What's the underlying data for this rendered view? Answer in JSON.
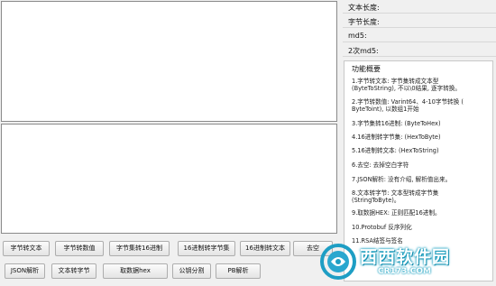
{
  "info": {
    "text_length_label": "文本长度:",
    "byte_length_label": "字节长度:",
    "md5_label": "md5:",
    "md5_twice_label": "2次md5:"
  },
  "description": {
    "title": "功能概要",
    "items": [
      "1.字节转文本: 字节集转成文本型\n(ByteToString), 不以\\0结果, 逐字转换。",
      "2.字节转数值: Varint64、4-10字节转换 (\nByteToint), 以数组1开始",
      "3.字节集转16进制: (ByteToHex)",
      "4.16进制转字节集: (HexToByte)",
      "5.16进制转文本: (HexToString)",
      "6.去空: 去掉空白字符",
      "7.JSON解析: 没有介绍, 解析值出来。",
      "8.文本转字节: 文本型转成字节集\n(StringToByte)。",
      "9.取数据HEX: 正则匹配16进制。",
      "10.Protobuf 反序列化",
      "11.RSA结签与签名"
    ]
  },
  "buttons_row1": [
    "字节转文本",
    "字节转数值",
    "字节集转16进制",
    "16进制转字节集",
    "16进制转文本",
    "去空"
  ],
  "buttons_row2": [
    "JSON解析",
    "文本转字节",
    "取数据hex",
    "公钥分割",
    "PB解析"
  ],
  "watermark": {
    "name": "西西软件园",
    "url": "CR173.COM"
  }
}
